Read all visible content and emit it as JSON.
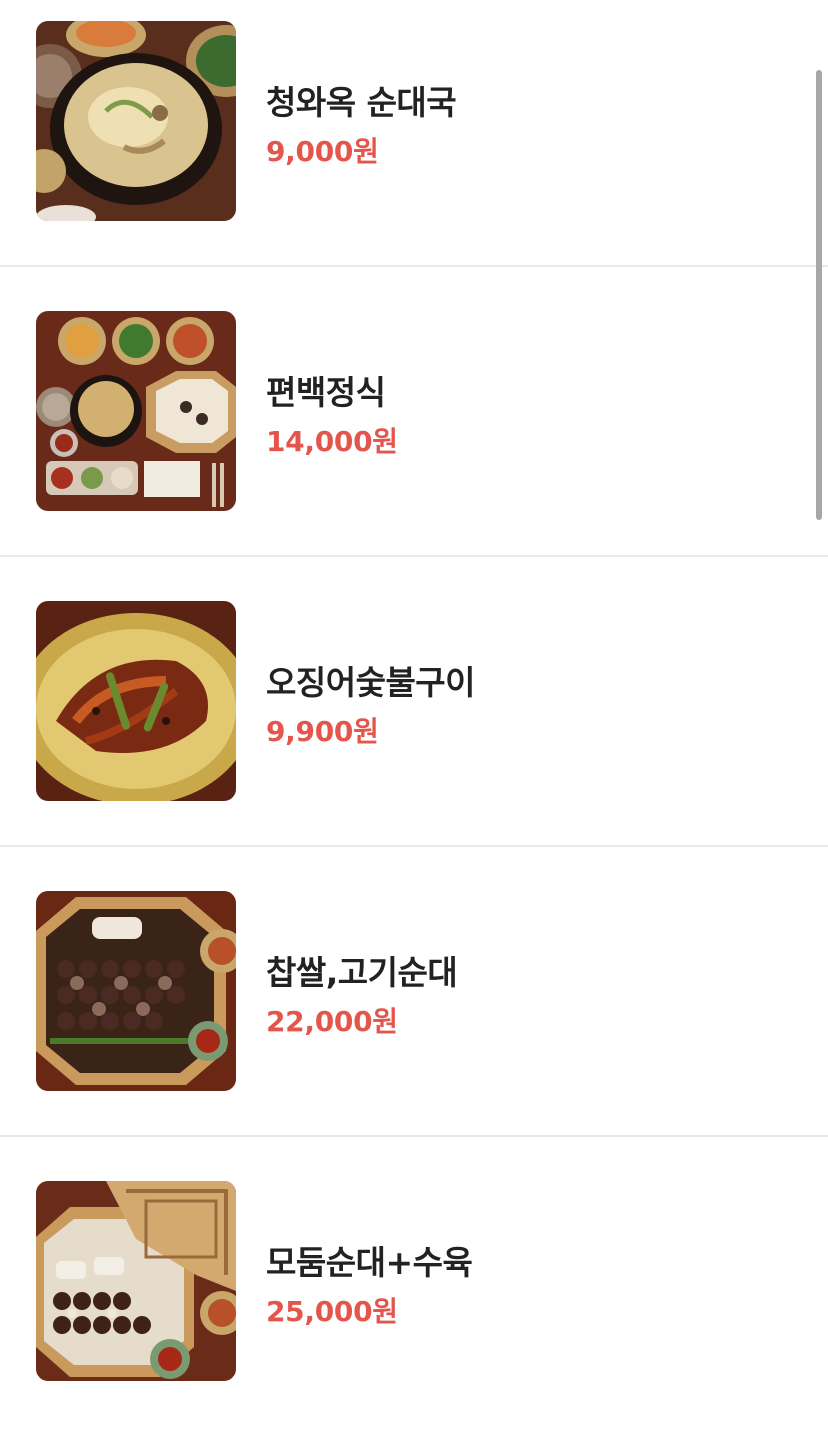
{
  "menu": {
    "items": [
      {
        "name": "청와옥 순대국",
        "price": "9,000원",
        "image_icon": "sundaeguk-photo"
      },
      {
        "name": "편백정식",
        "price": "14,000원",
        "image_icon": "set-meal-photo"
      },
      {
        "name": "오징어숯불구이",
        "price": "9,900원",
        "image_icon": "grilled-squid-photo"
      },
      {
        "name": "찹쌀,고기순대",
        "price": "22,000원",
        "image_icon": "sundae-platter-photo"
      },
      {
        "name": "모둠순대+수육",
        "price": "25,000원",
        "image_icon": "assorted-sundae-suyuk-photo"
      }
    ]
  },
  "colors": {
    "price": "#e4564c",
    "name": "#222222",
    "divider": "#e8e8e8",
    "scrollbar": "#a7a7a7"
  }
}
